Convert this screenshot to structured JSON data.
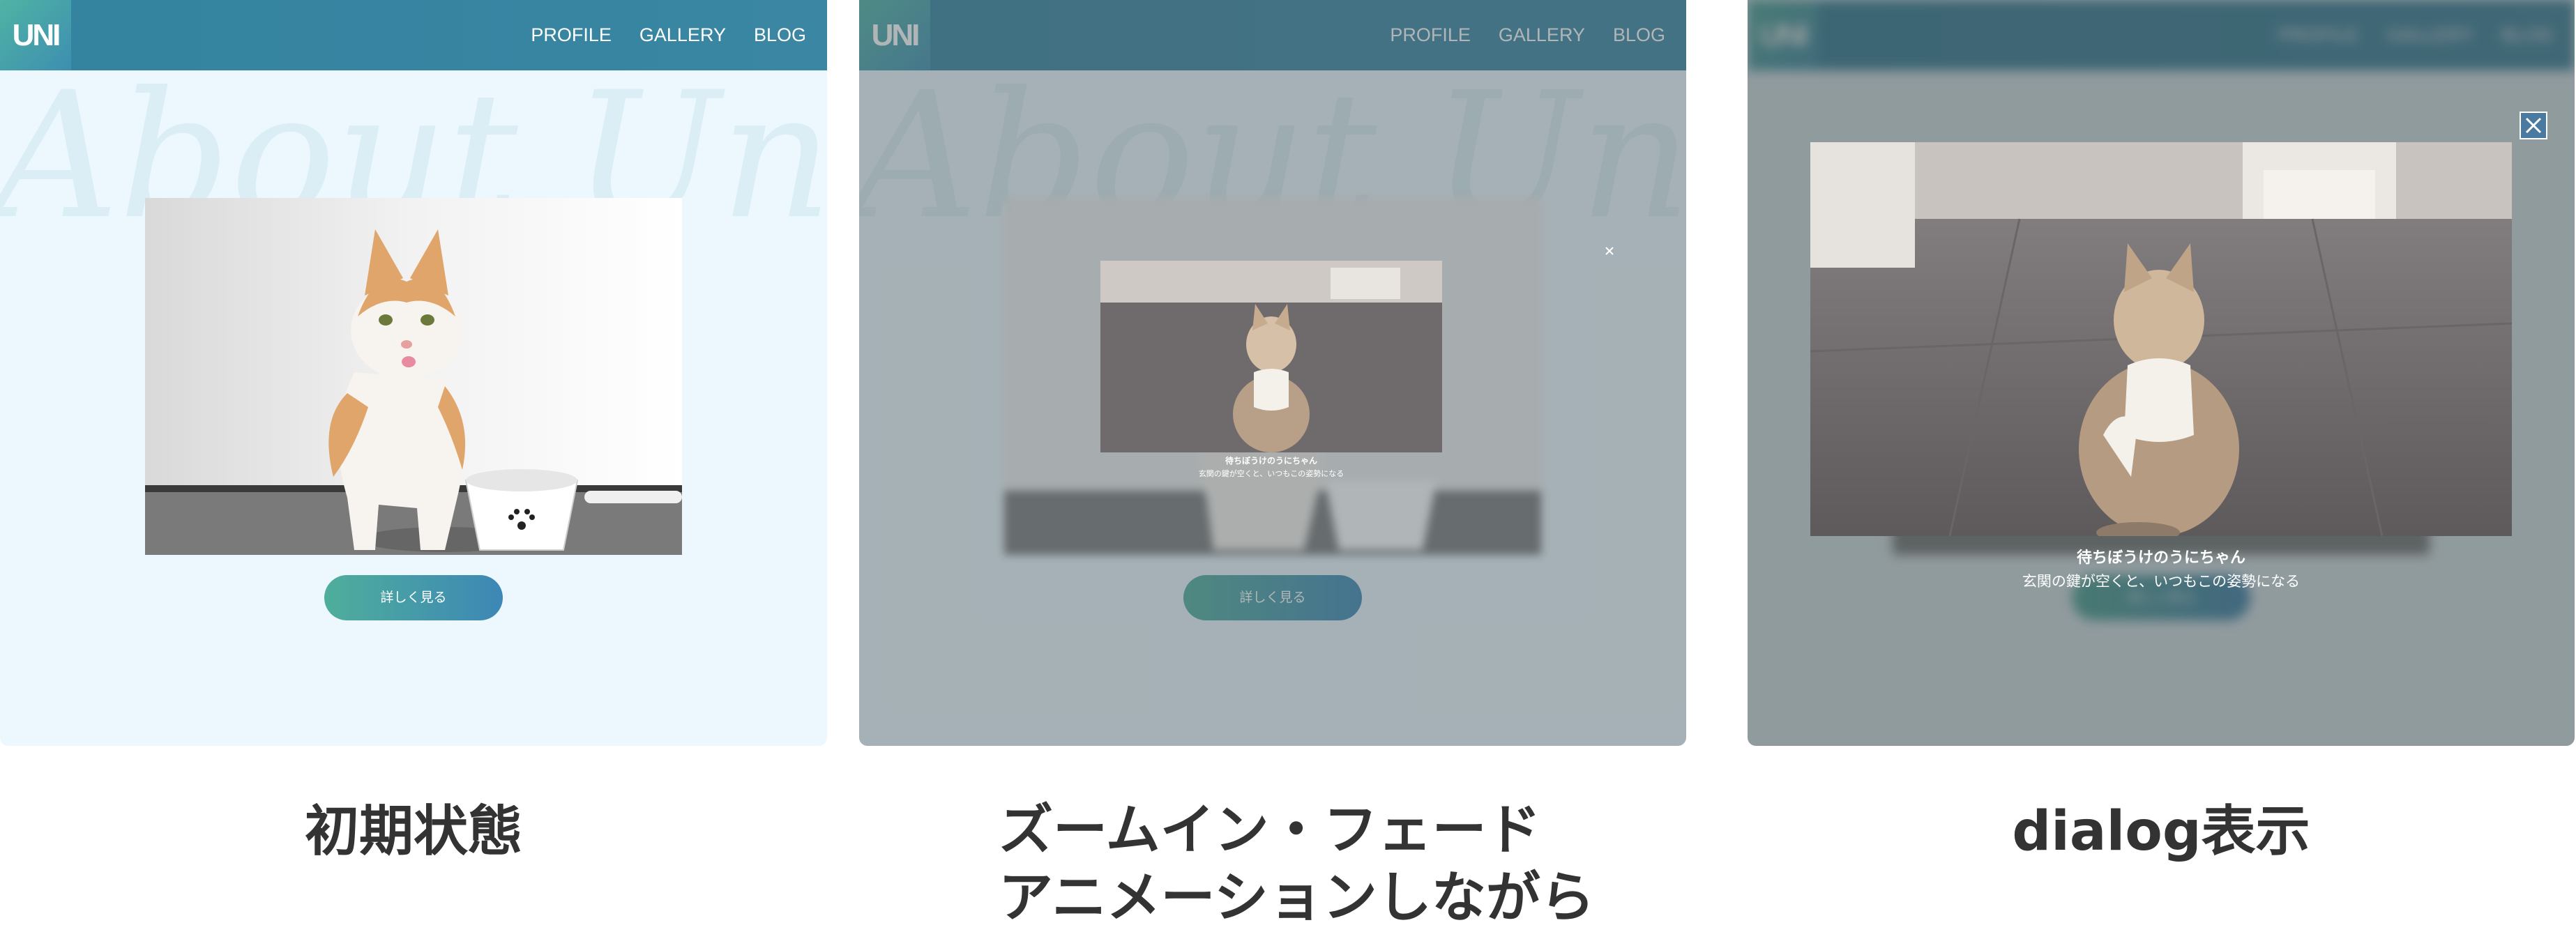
{
  "site": {
    "logo": "UNI",
    "nav": [
      "PROFILE",
      "GALLERY",
      "BLOG"
    ],
    "bg_script": "About Uni",
    "more_button": "詳しく見る"
  },
  "dialog": {
    "caption_title": "待ちぼうけのうにちゃん",
    "caption_text": "玄関の鍵が空くと、いつもこの姿勢になる"
  },
  "labels": {
    "initial": "初期状態",
    "animating_line1": "ズームイン・フェード",
    "animating_line2": "アニメーションしながら",
    "dialog": "dialog表示"
  },
  "colors": {
    "header": "#3a86a3",
    "page_bg": "#ecf8fd",
    "button_start": "#4fae9b",
    "button_end": "#3d87b6",
    "label_text": "#333333"
  }
}
